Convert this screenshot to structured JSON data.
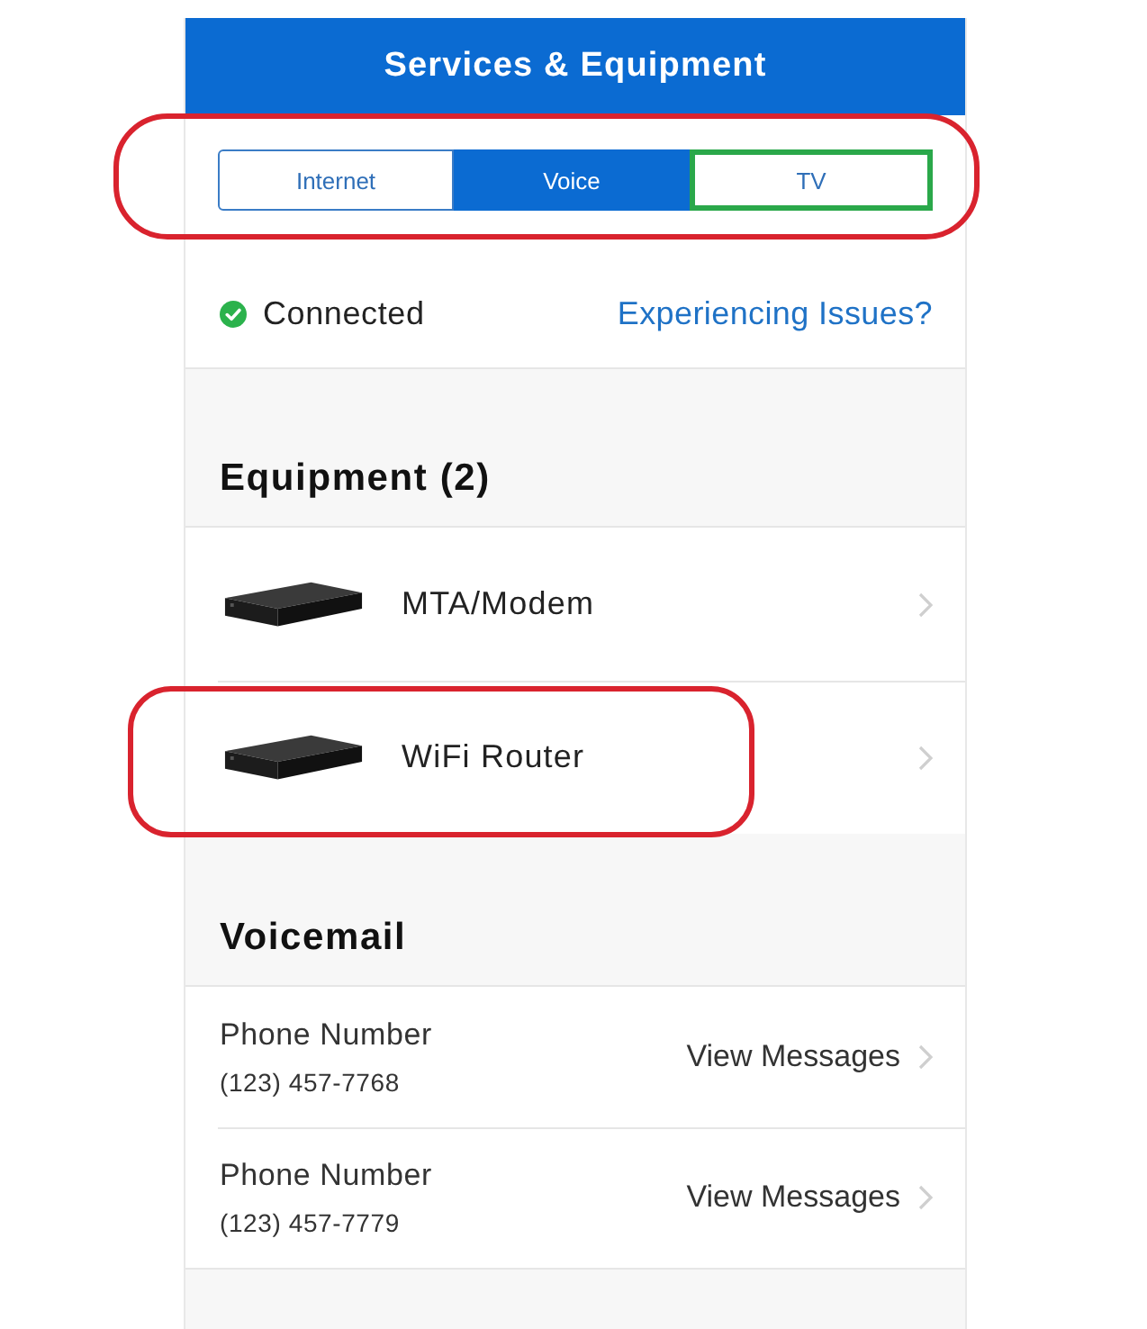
{
  "header": {
    "title": "Services & Equipment"
  },
  "tabs": {
    "circled": true,
    "items": [
      {
        "label": "Internet",
        "selected": false,
        "boxed": false
      },
      {
        "label": "Voice",
        "selected": true,
        "boxed": false
      },
      {
        "label": "TV",
        "selected": false,
        "boxed": true
      }
    ]
  },
  "status": {
    "label": "Connected",
    "ok": true,
    "link": "Experiencing Issues?"
  },
  "equipment": {
    "title": "Equipment (2)",
    "items": [
      {
        "name": "MTA/Modem",
        "circled": false
      },
      {
        "name": "WiFi Router",
        "circled": true
      }
    ]
  },
  "voicemail": {
    "title": "Voicemail",
    "items": [
      {
        "label": "Phone Number",
        "number": "(123) 457-7768",
        "action": "View Messages"
      },
      {
        "label": "Phone Number",
        "number": "(123) 457-7779",
        "action": "View Messages"
      }
    ]
  }
}
